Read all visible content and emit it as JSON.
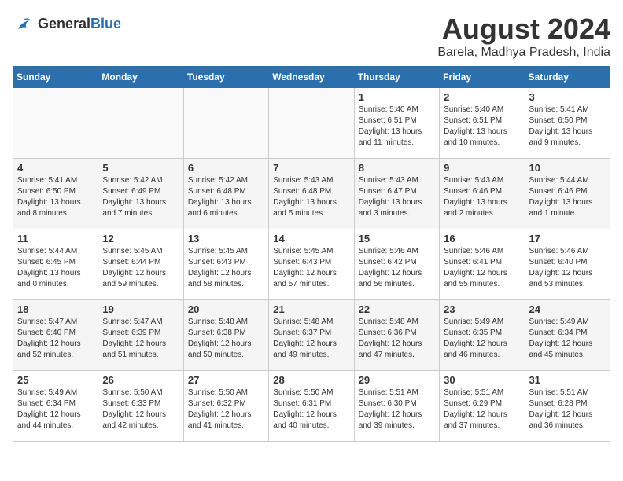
{
  "header": {
    "logo_general": "General",
    "logo_blue": "Blue",
    "month_year": "August 2024",
    "location": "Barela, Madhya Pradesh, India"
  },
  "weekdays": [
    "Sunday",
    "Monday",
    "Tuesday",
    "Wednesday",
    "Thursday",
    "Friday",
    "Saturday"
  ],
  "weeks": [
    [
      {
        "day": "",
        "empty": true
      },
      {
        "day": "",
        "empty": true
      },
      {
        "day": "",
        "empty": true
      },
      {
        "day": "",
        "empty": true
      },
      {
        "day": "1",
        "sunrise": "5:40 AM",
        "sunset": "6:51 PM",
        "daylight": "13 hours and 11 minutes."
      },
      {
        "day": "2",
        "sunrise": "5:40 AM",
        "sunset": "6:51 PM",
        "daylight": "13 hours and 10 minutes."
      },
      {
        "day": "3",
        "sunrise": "5:41 AM",
        "sunset": "6:50 PM",
        "daylight": "13 hours and 9 minutes."
      }
    ],
    [
      {
        "day": "4",
        "sunrise": "5:41 AM",
        "sunset": "6:50 PM",
        "daylight": "13 hours and 8 minutes."
      },
      {
        "day": "5",
        "sunrise": "5:42 AM",
        "sunset": "6:49 PM",
        "daylight": "13 hours and 7 minutes."
      },
      {
        "day": "6",
        "sunrise": "5:42 AM",
        "sunset": "6:48 PM",
        "daylight": "13 hours and 6 minutes."
      },
      {
        "day": "7",
        "sunrise": "5:43 AM",
        "sunset": "6:48 PM",
        "daylight": "13 hours and 5 minutes."
      },
      {
        "day": "8",
        "sunrise": "5:43 AM",
        "sunset": "6:47 PM",
        "daylight": "13 hours and 3 minutes."
      },
      {
        "day": "9",
        "sunrise": "5:43 AM",
        "sunset": "6:46 PM",
        "daylight": "13 hours and 2 minutes."
      },
      {
        "day": "10",
        "sunrise": "5:44 AM",
        "sunset": "6:46 PM",
        "daylight": "13 hours and 1 minute."
      }
    ],
    [
      {
        "day": "11",
        "sunrise": "5:44 AM",
        "sunset": "6:45 PM",
        "daylight": "13 hours and 0 minutes."
      },
      {
        "day": "12",
        "sunrise": "5:45 AM",
        "sunset": "6:44 PM",
        "daylight": "12 hours and 59 minutes."
      },
      {
        "day": "13",
        "sunrise": "5:45 AM",
        "sunset": "6:43 PM",
        "daylight": "12 hours and 58 minutes."
      },
      {
        "day": "14",
        "sunrise": "5:45 AM",
        "sunset": "6:43 PM",
        "daylight": "12 hours and 57 minutes."
      },
      {
        "day": "15",
        "sunrise": "5:46 AM",
        "sunset": "6:42 PM",
        "daylight": "12 hours and 56 minutes."
      },
      {
        "day": "16",
        "sunrise": "5:46 AM",
        "sunset": "6:41 PM",
        "daylight": "12 hours and 55 minutes."
      },
      {
        "day": "17",
        "sunrise": "5:46 AM",
        "sunset": "6:40 PM",
        "daylight": "12 hours and 53 minutes."
      }
    ],
    [
      {
        "day": "18",
        "sunrise": "5:47 AM",
        "sunset": "6:40 PM",
        "daylight": "12 hours and 52 minutes."
      },
      {
        "day": "19",
        "sunrise": "5:47 AM",
        "sunset": "6:39 PM",
        "daylight": "12 hours and 51 minutes."
      },
      {
        "day": "20",
        "sunrise": "5:48 AM",
        "sunset": "6:38 PM",
        "daylight": "12 hours and 50 minutes."
      },
      {
        "day": "21",
        "sunrise": "5:48 AM",
        "sunset": "6:37 PM",
        "daylight": "12 hours and 49 minutes."
      },
      {
        "day": "22",
        "sunrise": "5:48 AM",
        "sunset": "6:36 PM",
        "daylight": "12 hours and 47 minutes."
      },
      {
        "day": "23",
        "sunrise": "5:49 AM",
        "sunset": "6:35 PM",
        "daylight": "12 hours and 46 minutes."
      },
      {
        "day": "24",
        "sunrise": "5:49 AM",
        "sunset": "6:34 PM",
        "daylight": "12 hours and 45 minutes."
      }
    ],
    [
      {
        "day": "25",
        "sunrise": "5:49 AM",
        "sunset": "6:34 PM",
        "daylight": "12 hours and 44 minutes."
      },
      {
        "day": "26",
        "sunrise": "5:50 AM",
        "sunset": "6:33 PM",
        "daylight": "12 hours and 42 minutes."
      },
      {
        "day": "27",
        "sunrise": "5:50 AM",
        "sunset": "6:32 PM",
        "daylight": "12 hours and 41 minutes."
      },
      {
        "day": "28",
        "sunrise": "5:50 AM",
        "sunset": "6:31 PM",
        "daylight": "12 hours and 40 minutes."
      },
      {
        "day": "29",
        "sunrise": "5:51 AM",
        "sunset": "6:30 PM",
        "daylight": "12 hours and 39 minutes."
      },
      {
        "day": "30",
        "sunrise": "5:51 AM",
        "sunset": "6:29 PM",
        "daylight": "12 hours and 37 minutes."
      },
      {
        "day": "31",
        "sunrise": "5:51 AM",
        "sunset": "6:28 PM",
        "daylight": "12 hours and 36 minutes."
      }
    ]
  ]
}
